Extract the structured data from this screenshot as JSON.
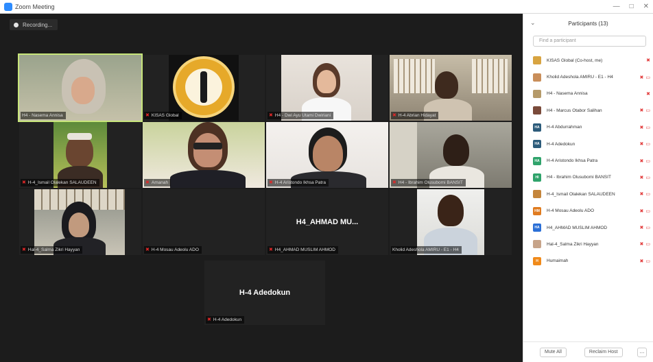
{
  "window": {
    "title": "Zoom Meeting",
    "controls": [
      "—",
      "□",
      "✕"
    ]
  },
  "recording": {
    "label": "Recording..."
  },
  "tiles": [
    {
      "name": "H4 - Nasema Annisa"
    },
    {
      "name": "KISAS Global"
    },
    {
      "name": "H4 - Dwi Ayu Utami Dwiriani"
    },
    {
      "name": "H-4 Abrian Hidayat"
    },
    {
      "name": "H-4_Ismail Olalekan SALAUDEEN"
    },
    {
      "name": "Amanah"
    },
    {
      "name": "H-4 Aristondo Ikhsa Patra"
    },
    {
      "name": "H4 - Ibrahim Olusubomi BANSIT"
    },
    {
      "name": "Hal-4_Salma Zikri Hayyan"
    },
    {
      "name": "H-4 Mosau Adeolu ADO"
    },
    {
      "name": "H4_AHMAD MUSLIM AHMOD",
      "display": "H4_AHMAD  MU..."
    },
    {
      "name": "Kholid Adeshola AMIRU - E1 - H4"
    },
    {
      "name": "H-4 Adedokun",
      "display": "H-4 Adedokun"
    }
  ],
  "participants_panel": {
    "title": "Participants (13)",
    "search_placeholder": "Find a participant",
    "items": [
      {
        "name": "KISAS Global (Co-host, me)",
        "initials": "",
        "color": "#d8a441",
        "status": "mic"
      },
      {
        "name": "Kholid Adeshola AMIRU - E1 - H4",
        "initials": "",
        "color": "#c98e5a",
        "status": "mic-cam"
      },
      {
        "name": "H4 - Nasema Annisa",
        "initials": "",
        "color": "#b59a6a",
        "status": "mic"
      },
      {
        "name": "H4 - Marcus Otabor Salihan",
        "initials": "",
        "color": "#7a4a3a",
        "status": "mic-cam"
      },
      {
        "name": "H-4 Abdurrahman",
        "initials": "HA",
        "color": "#2c5b7a",
        "status": "mic-cam"
      },
      {
        "name": "H-4 Adedokun",
        "initials": "HA",
        "color": "#2c5b7a",
        "status": "mic-cam"
      },
      {
        "name": "H-4 Aristondo Ikhsa Patra",
        "initials": "HA",
        "color": "#2fa36b",
        "status": "mic-cam"
      },
      {
        "name": "H4 - Ibrahim Olusubomi BANSIT",
        "initials": "HI",
        "color": "#2fa36b",
        "status": "mic-cam"
      },
      {
        "name": "H-4_Ismail Olalekan SALAUDEEN",
        "initials": "",
        "color": "#c4853b",
        "status": "mic-cam"
      },
      {
        "name": "H-4 Mosau Adeolu ADO",
        "initials": "HM",
        "color": "#e07b1f",
        "status": "mic-cam"
      },
      {
        "name": "H4_AHMAD MUSLIM AHMOD",
        "initials": "HA",
        "color": "#2b6fd6",
        "status": "mic-cam"
      },
      {
        "name": "Hal-4_Salma Zikri Hayyan",
        "initials": "",
        "color": "#c7a48a",
        "status": "mic-cam"
      },
      {
        "name": "Humaimah",
        "initials": "H",
        "color": "#f08a1a",
        "status": "mic-cam"
      }
    ],
    "footer": {
      "mute_all": "Mute All",
      "reclaim_host": "Reclaim Host",
      "more": "..."
    }
  }
}
